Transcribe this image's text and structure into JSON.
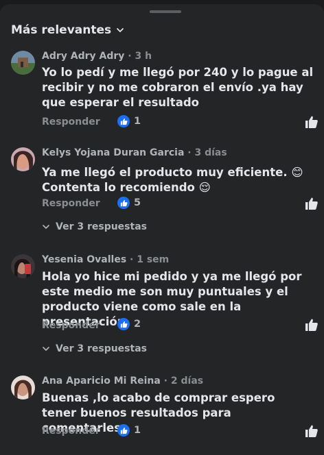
{
  "header": {
    "sort_label": "Más relevantes"
  },
  "colors": {
    "accent": "#1d6ff2",
    "background": "#242527",
    "text_primary": "#e4e6eb",
    "text_secondary": "#b0b3b8"
  },
  "comments": [
    {
      "author": "Adry Adry Adry",
      "time": " · 3 h",
      "text": "Yo lo pedí y me llegó por 240 y lo pague al recibir y no me cobraron el envío .ya hay que esperar el resultado",
      "reply_label": "Responder",
      "likes": "1"
    },
    {
      "author": "Kelys Yojana Duran Garcia",
      "time": " · 3 días",
      "text": "Ya me llegó el producto muy eficiente. 😊 Contenta  lo recomiendo 😌",
      "reply_label": "Responder",
      "likes": "5",
      "view_replies": "Ver 3 respuestas"
    },
    {
      "author": "Yesenia Ovalles",
      "time": " · 1 sem",
      "text": "Hola yo hice mi pedido y ya me llegó por este medio me son muy puntuales y el producto viene como sale en la presentación",
      "reply_label": "Responder",
      "likes": "2",
      "view_replies": "Ver 3 respuestas"
    },
    {
      "author": "Ana Aparicio Mi Reina",
      "time": " · 2 días",
      "text": "Buenas ,lo acabo de comprar espero tener buenos resultados para comentarles",
      "reply_label": "Responder",
      "likes": "1"
    }
  ]
}
